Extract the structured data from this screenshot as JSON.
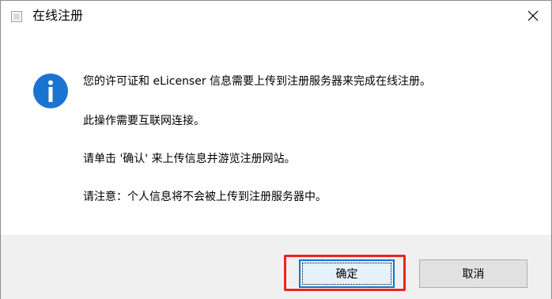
{
  "window": {
    "title": "在线注册",
    "close_icon": "close-icon",
    "app_icon": "window-icon"
  },
  "message": {
    "icon": "info-icon",
    "icon_color": "#1b75d0",
    "lines": [
      "您的许可证和 eLicenser 信息需要上传到注册服务器来完成在线注册。",
      "此操作需要互联网连接。",
      "请单击 '确认' 来上传信息并游览注册网站。",
      "请注意：个人信息将不会被上传到注册服务器中。"
    ]
  },
  "buttons": {
    "ok_label": "确定",
    "cancel_label": "取消"
  },
  "colors": {
    "highlight": "#e8261f",
    "focus_border": "#0078d7",
    "footer_bg": "#f0f0f0"
  }
}
